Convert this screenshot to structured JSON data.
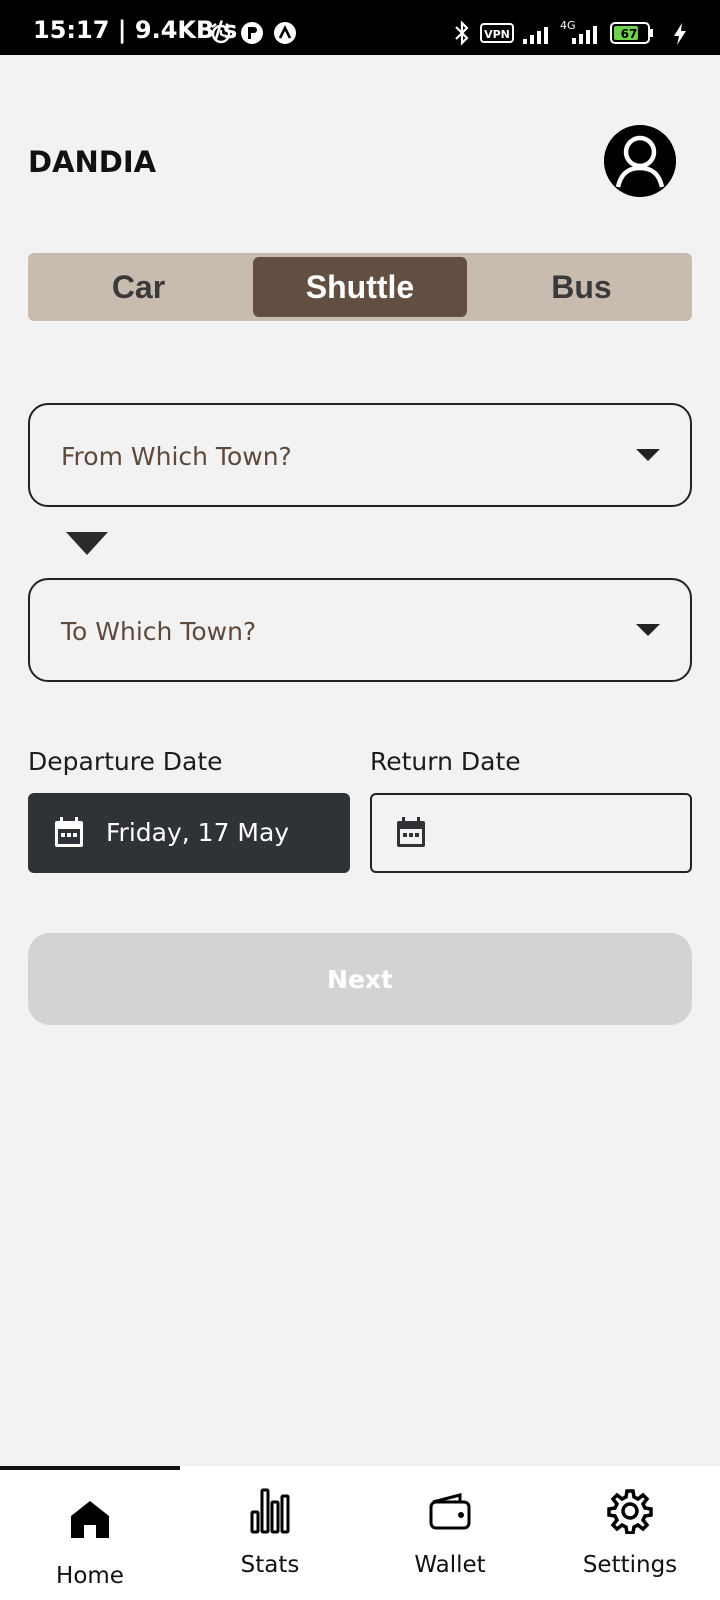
{
  "status_bar": {
    "time_speed": "15:17 | 9.4KB/s",
    "vpn": "VPN",
    "network": "4G",
    "battery": "67"
  },
  "header": {
    "title": "DANDIA"
  },
  "transport_tabs": [
    {
      "label": "Car",
      "active": false
    },
    {
      "label": "Shuttle",
      "active": true
    },
    {
      "label": "Bus",
      "active": false
    }
  ],
  "route": {
    "from_placeholder": "From Which Town?",
    "to_placeholder": "To Which Town?"
  },
  "dates": {
    "departure_label": "Departure Date",
    "departure_value": "Friday, 17 May",
    "return_label": "Return Date",
    "return_value": ""
  },
  "next_label": "Next",
  "bottom_nav": [
    {
      "label": "Home",
      "icon": "home-icon",
      "active": true
    },
    {
      "label": "Stats",
      "icon": "stats-icon",
      "active": false
    },
    {
      "label": "Wallet",
      "icon": "wallet-icon",
      "active": false
    },
    {
      "label": "Settings",
      "icon": "settings-icon",
      "active": false
    }
  ],
  "colors": {
    "accent": "#634f41",
    "tab_bg": "#c8bcb0",
    "date_filled_bg": "#2f3236",
    "next_disabled_bg": "#d3d3d3",
    "background": "#f2f2f2"
  }
}
